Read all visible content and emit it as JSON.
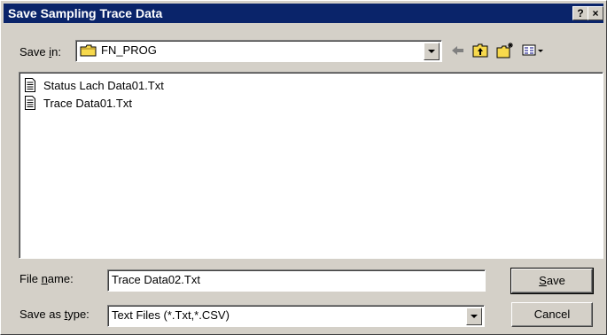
{
  "window": {
    "title": "Save Sampling Trace Data",
    "help_label": "?",
    "close_label": "×"
  },
  "save_in": {
    "label_pre": "Save ",
    "label_underline": "i",
    "label_post": "n:",
    "folder": "FN_PROG"
  },
  "toolbar": {
    "icons": [
      "back-arrow-icon",
      "up-one-level-icon",
      "create-new-folder-icon",
      "view-menu-icon"
    ]
  },
  "files": [
    {
      "name": "Status Lach Data01.Txt",
      "icon": "text-file-icon"
    },
    {
      "name": "Trace Data01.Txt",
      "icon": "text-file-icon"
    }
  ],
  "file_name": {
    "label_pre": "File ",
    "label_underline": "n",
    "label_post": "ame:",
    "value": "Trace Data02.Txt"
  },
  "save_as_type": {
    "label_pre": "Save as ",
    "label_underline": "t",
    "label_post": "ype:",
    "value": "Text Files (*.Txt,*.CSV)"
  },
  "buttons": {
    "save_underline": "S",
    "save_rest": "ave",
    "cancel": "Cancel"
  },
  "colors": {
    "titlebar": "#0a246a",
    "face": "#d4d0c8",
    "folder": "#f7d94c"
  }
}
